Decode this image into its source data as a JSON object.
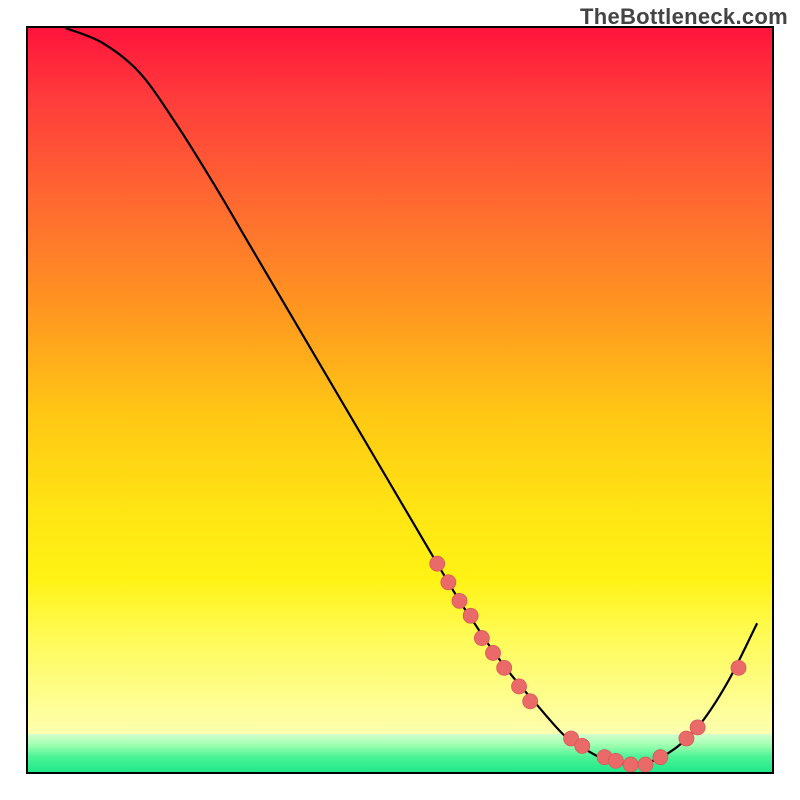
{
  "watermark_text": "TheBottleneck.com",
  "chart_data": {
    "type": "line",
    "title": "",
    "xlabel": "",
    "ylabel": "",
    "xlim": [
      0,
      100
    ],
    "ylim": [
      0,
      100
    ],
    "series": [
      {
        "name": "curve",
        "x": [
          5,
          10,
          15,
          20,
          25,
          30,
          35,
          40,
          45,
          50,
          55,
          58,
          60,
          62,
          65,
          68,
          72,
          75,
          78,
          82,
          86,
          90,
          94,
          98
        ],
        "y": [
          100,
          98,
          94,
          87,
          79,
          70.5,
          62,
          53.5,
          45,
          36.5,
          28,
          23,
          20,
          17,
          13,
          9.5,
          5,
          3,
          1.5,
          1,
          2.5,
          6,
          12,
          20
        ]
      }
    ],
    "markers": [
      {
        "name": "cluster-mid-1",
        "x": 55.0,
        "y": 28.0
      },
      {
        "name": "cluster-mid-2",
        "x": 56.5,
        "y": 25.5
      },
      {
        "name": "cluster-mid-3",
        "x": 58.0,
        "y": 23.0
      },
      {
        "name": "cluster-mid-4",
        "x": 59.5,
        "y": 21.0
      },
      {
        "name": "cluster-mid-5",
        "x": 61.0,
        "y": 18.0
      },
      {
        "name": "cluster-mid-6",
        "x": 62.5,
        "y": 16.0
      },
      {
        "name": "cluster-mid-7",
        "x": 64.0,
        "y": 14.0
      },
      {
        "name": "cluster-mid-8",
        "x": 66.0,
        "y": 11.5
      },
      {
        "name": "cluster-mid-9",
        "x": 67.5,
        "y": 9.5
      },
      {
        "name": "bottom-1",
        "x": 73.0,
        "y": 4.5
      },
      {
        "name": "bottom-2",
        "x": 74.5,
        "y": 3.5
      },
      {
        "name": "bottom-3",
        "x": 77.5,
        "y": 2.0
      },
      {
        "name": "bottom-4",
        "x": 79.0,
        "y": 1.5
      },
      {
        "name": "bottom-5",
        "x": 81.0,
        "y": 1.0
      },
      {
        "name": "bottom-6",
        "x": 83.0,
        "y": 1.0
      },
      {
        "name": "bottom-7",
        "x": 85.0,
        "y": 2.0
      },
      {
        "name": "upturn-1",
        "x": 88.5,
        "y": 4.5
      },
      {
        "name": "upturn-2",
        "x": 90.0,
        "y": 6.0
      },
      {
        "name": "upturn-3",
        "x": 95.5,
        "y": 14.0
      }
    ],
    "colors": {
      "curve": "#000000",
      "marker_fill": "#ea6a6a",
      "marker_stroke": "#d95858"
    }
  }
}
